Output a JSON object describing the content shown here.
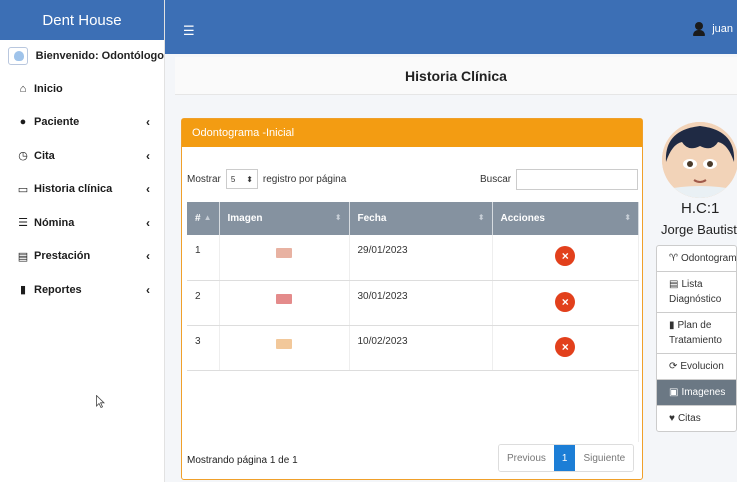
{
  "sidebar": {
    "brand": "Dent House",
    "welcome": "Bienvenido: Odontólogo",
    "items": [
      {
        "label": "Inicio",
        "icon": "home-icon",
        "chevron": ""
      },
      {
        "label": "Paciente",
        "icon": "user-icon",
        "chevron": "‹"
      },
      {
        "label": "Cita",
        "icon": "clock-icon",
        "chevron": "‹"
      },
      {
        "label": "Historia clínica",
        "icon": "id-card-icon",
        "chevron": "‹"
      },
      {
        "label": "Nómina",
        "icon": "list-icon",
        "chevron": "‹"
      },
      {
        "label": "Prestación",
        "icon": "file-icon",
        "chevron": "‹"
      },
      {
        "label": "Reportes",
        "icon": "report-icon",
        "chevron": "‹"
      }
    ]
  },
  "topbar": {
    "menu_icon": "☰",
    "username": "juan"
  },
  "page": {
    "title": "Historia Clínica"
  },
  "card": {
    "header": "Odontograma -Inicial",
    "show_label": "Mostrar",
    "page_size": "5",
    "per_page_label": "registro por página",
    "search_label": "Buscar",
    "search_value": "",
    "columns": [
      "#",
      "Imagen",
      "Fecha",
      "Acciones"
    ],
    "rows": [
      {
        "num": "1",
        "fecha": "29/01/2023",
        "thumb_color": "#e8b2a2"
      },
      {
        "num": "2",
        "fecha": "30/01/2023",
        "thumb_color": "#e48b8b"
      },
      {
        "num": "3",
        "fecha": "10/02/2023",
        "thumb_color": "#f2c89a"
      }
    ],
    "footer": "Mostrando página 1 de 1",
    "pager": {
      "previous": "Previous",
      "current": "1",
      "next": "Siguiente"
    }
  },
  "profile": {
    "hc": "H.C:1",
    "name": "Jorge Bautista",
    "menu": [
      {
        "label": "Odontograma",
        "icon": "tooth-icon",
        "glyph": "♈"
      },
      {
        "label": "Lista Diagnóstico",
        "icon": "list-alt-icon",
        "glyph": "▤"
      },
      {
        "label": "Plan de Tratamiento",
        "icon": "clipboard-icon",
        "glyph": "▮"
      },
      {
        "label": "Evolucion",
        "icon": "refresh-icon",
        "glyph": "⟳"
      },
      {
        "label": "Imagenes",
        "icon": "image-icon",
        "glyph": "▣"
      },
      {
        "label": "Citas",
        "icon": "heart-icon",
        "glyph": "♥"
      }
    ]
  },
  "colors": {
    "primary": "#3c6fb5",
    "accent": "#f39c12",
    "table_header": "#8592a0",
    "danger": "#e2401c",
    "pager_active": "#1c7ed6"
  }
}
